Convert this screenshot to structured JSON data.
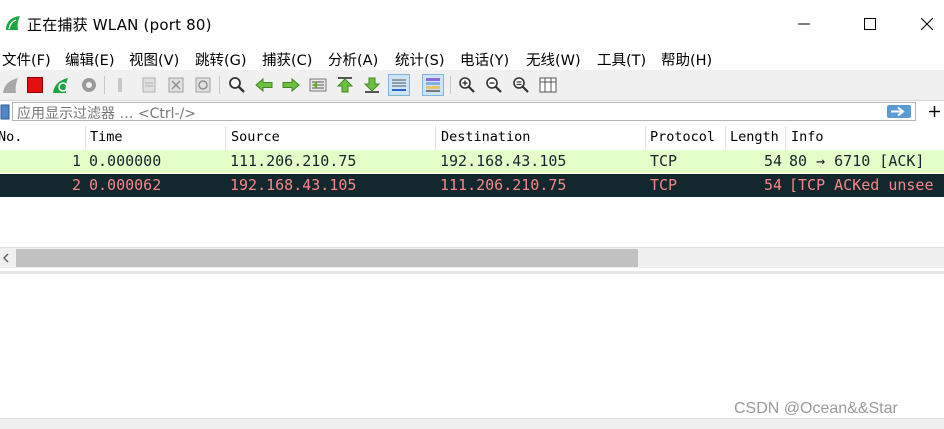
{
  "window": {
    "title": "正在捕获 WLAN (port 80)",
    "controls": [
      "minimize",
      "maximize",
      "close"
    ]
  },
  "menu": [
    "文件(F)",
    "编辑(E)",
    "视图(V)",
    "跳转(G)",
    "捕获(C)",
    "分析(A)",
    "统计(S)",
    "电话(Y)",
    "无线(W)",
    "工具(T)",
    "帮助(H)"
  ],
  "toolbar": {
    "icons": [
      "shark-fin-icon",
      "stop-capture-icon",
      "restart-capture-icon",
      "capture-options-icon",
      "open-file-icon",
      "save-file-icon",
      "close-file-icon",
      "reload-icon",
      "find-packet-icon",
      "go-back-icon",
      "go-forward-icon",
      "go-to-packet-icon",
      "go-first-icon",
      "go-last-icon",
      "autoscroll-icon",
      "colorize-icon",
      "zoom-in-icon",
      "zoom-out-icon",
      "normal-size-icon",
      "resize-columns-icon"
    ],
    "active": [
      "autoscroll-icon",
      "colorize-icon"
    ]
  },
  "filter": {
    "placeholder": "应用显示过滤器 … <Ctrl-/>"
  },
  "packet_list": {
    "columns": [
      "No.",
      "Time",
      "Source",
      "Destination",
      "Protocol",
      "Length",
      "Info"
    ],
    "rows": [
      {
        "no": "1",
        "time": "0.000000",
        "source": "111.206.210.75",
        "destination": "192.168.43.105",
        "protocol": "TCP",
        "length": "54",
        "info": "80 → 6710 [ACK]"
      },
      {
        "no": "2",
        "time": "0.000062",
        "source": "192.168.43.105",
        "destination": "111.206.210.75",
        "protocol": "TCP",
        "length": "54",
        "info": "[TCP ACKed unsee"
      }
    ],
    "row_colors": {
      "tcp_normal_bg": "#e4ffc7",
      "tcp_normal_fg": "#12272e",
      "tcp_bad_bg": "#12272e",
      "tcp_bad_fg": "#f78787"
    }
  },
  "watermark": "CSDN @Ocean&&Star"
}
